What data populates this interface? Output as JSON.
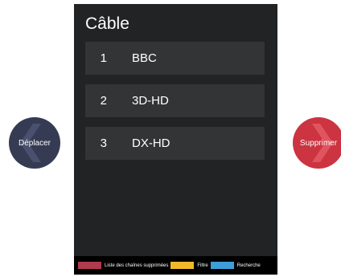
{
  "panel": {
    "title": "Câble"
  },
  "channels": [
    {
      "number": "1",
      "name": "BBC"
    },
    {
      "number": "2",
      "name": "3D-HD"
    },
    {
      "number": "3",
      "name": "DX-HD"
    }
  ],
  "side_buttons": {
    "move_label": "Déplacer",
    "delete_label": "Supprimer"
  },
  "footer_legend": [
    {
      "label": "Liste des chaînes supprimées",
      "color": "#b03a4e"
    },
    {
      "label": "Filtre",
      "color": "#f0b92b"
    },
    {
      "label": "Recherche",
      "color": "#3e9fd8"
    }
  ],
  "colors": {
    "panel_bg": "#212325",
    "row_bg": "#323436",
    "move_button": "#353b52",
    "delete_button": "#cb3440"
  }
}
